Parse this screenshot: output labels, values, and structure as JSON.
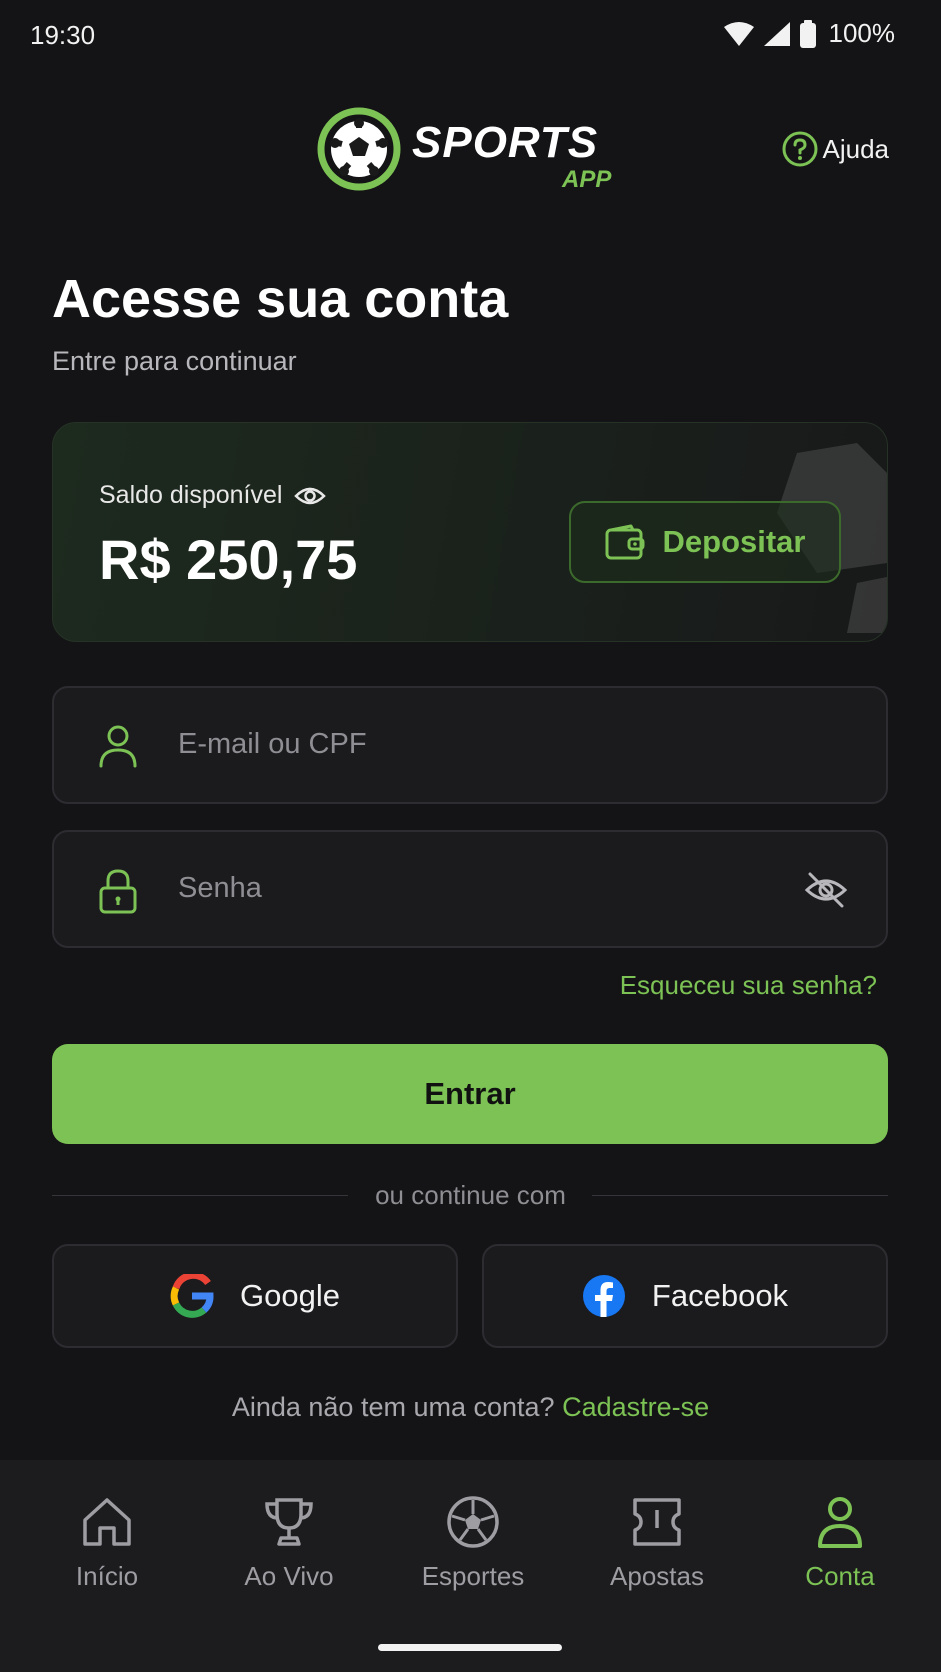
{
  "status": {
    "time": "19:30",
    "battery": "100%"
  },
  "header": {
    "logo_word": "SPORTS",
    "logo_sub": "APP",
    "help_label": "Ajuda"
  },
  "page": {
    "title": "Acesse sua conta",
    "subtitle": "Entre para continuar"
  },
  "balance": {
    "label": "Saldo disponível",
    "amount": "R$ 250,75",
    "deposit_label": "Depositar"
  },
  "form": {
    "email_placeholder": "E-mail ou CPF",
    "password_placeholder": "Senha",
    "forgot_label": "Esqueceu sua senha?",
    "submit_label": "Entrar"
  },
  "social": {
    "divider": "ou continue com",
    "google_label": "Google",
    "facebook_label": "Facebook"
  },
  "signup": {
    "prompt": "Ainda não tem uma conta?",
    "link": "Cadastre-se"
  },
  "nav": {
    "items": [
      {
        "label": "Início",
        "icon": "home-icon"
      },
      {
        "label": "Ao Vivo",
        "icon": "trophy-icon"
      },
      {
        "label": "Esportes",
        "icon": "soccer-ball-icon"
      },
      {
        "label": "Apostas",
        "icon": "ticket-icon"
      },
      {
        "label": "Conta",
        "icon": "user-icon"
      }
    ],
    "active": "Conta"
  },
  "colors": {
    "accent": "#7cc254",
    "background": "#141416",
    "surface": "#1b1b1e"
  }
}
